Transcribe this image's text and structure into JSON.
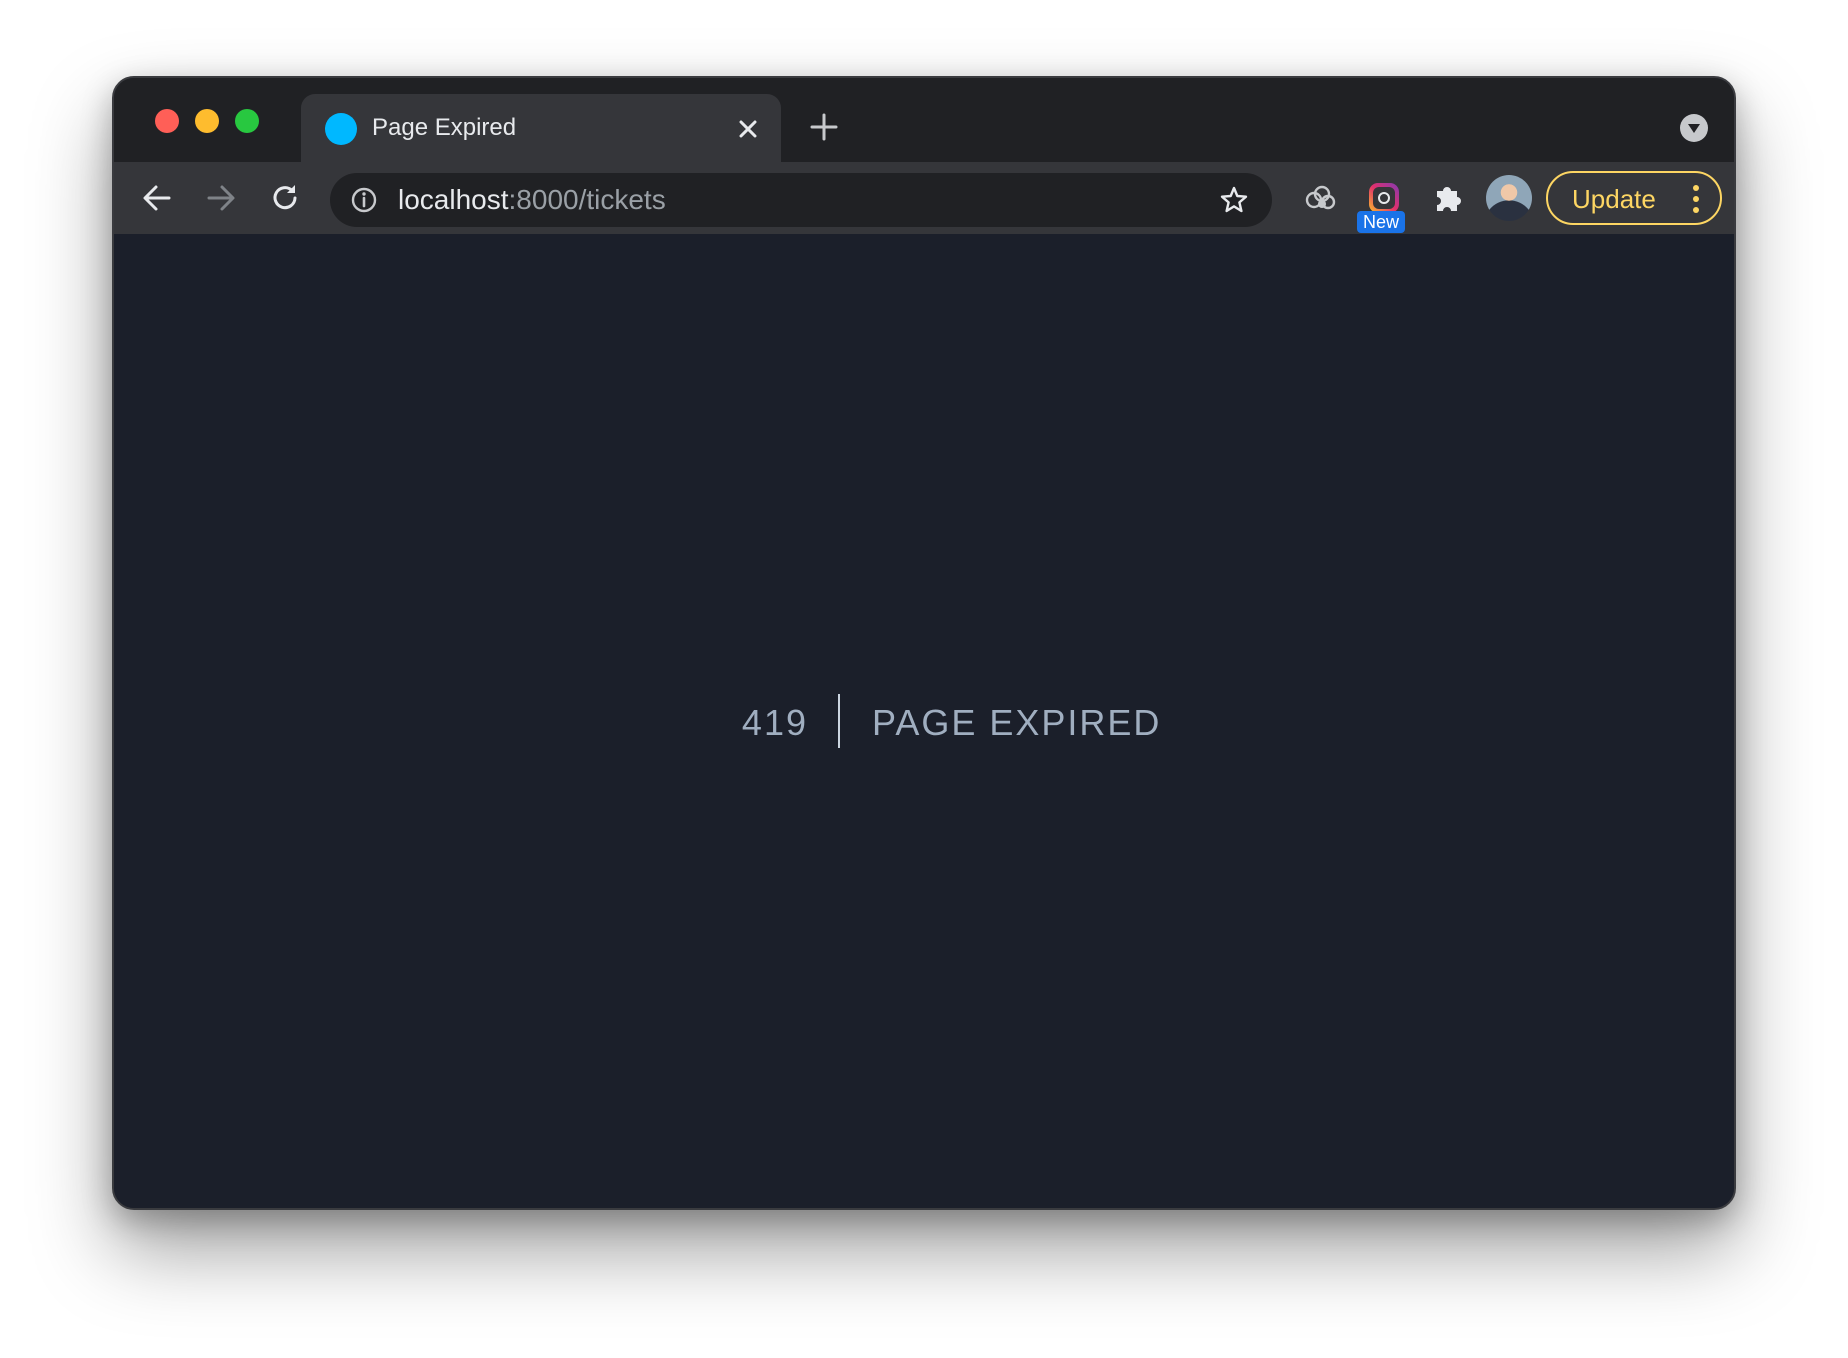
{
  "browser": {
    "tab": {
      "title": "Page Expired",
      "favicon_color": "#00b8ff",
      "close_icon": "close-icon"
    },
    "new_tab_icon": "plus-icon",
    "tab_search_icon": "chevron-down-icon",
    "toolbar": {
      "back_icon": "arrow-left-icon",
      "forward_icon": "arrow-right-icon",
      "reload_icon": "reload-icon",
      "url_host": "localhost",
      "url_rest": ":8000/tickets",
      "site_info_icon": "info-icon",
      "bookmark_icon": "star-icon",
      "extensions": [
        {
          "name": "clouds-extension-icon"
        },
        {
          "name": "instagram-extension-icon",
          "badge": "New"
        },
        {
          "name": "puzzle-icon"
        }
      ],
      "update_label": "Update",
      "update_color": "#fdd663"
    }
  },
  "page": {
    "error_code": "419",
    "error_message": "PAGE EXPIRED"
  }
}
